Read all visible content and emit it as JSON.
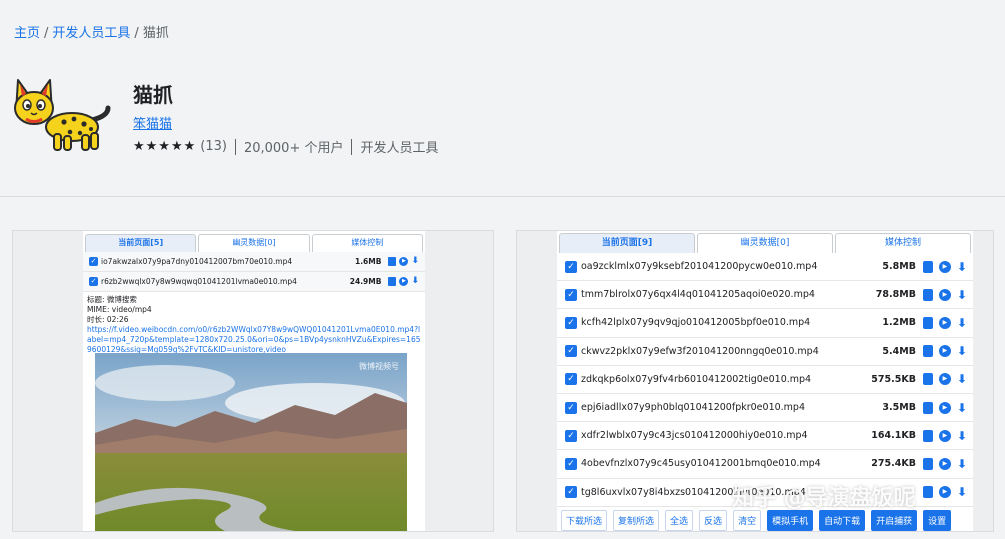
{
  "breadcrumb": {
    "home": "主页",
    "category": "开发人员工具",
    "current": "猫抓"
  },
  "extension": {
    "name": "猫抓",
    "author": "笨猫猫",
    "stars": "★★★★★",
    "rating_count": "(13)",
    "users": "20,000+ 个用户",
    "category": "开发人员工具"
  },
  "left_shot": {
    "tabs": [
      "当前页面[5]",
      "幽灵数据[0]",
      "媒体控制"
    ],
    "rows": [
      {
        "name": "io7akwzalx07y9pa7dny010412007bm70e010.mp4",
        "size": "1.6MB"
      },
      {
        "name": "r6zb2wwqlx07y8w9wqwq01041201lvma0e010.mp4",
        "size": "24.9MB"
      }
    ],
    "info": {
      "title": "标题: 微博搜索",
      "mime": "MIME: video/mp4",
      "duration": "时长: 02:26",
      "url": "https://f.video.weibocdn.com/o0/r6zb2WWqlx07Y8w9wQWQ01041201Lvma0E010.mp4?label=mp4_720p&template=1280x720.25.0&ori=0&ps=1BVp4ysnknHVZu&Expires=1659600129&ssig=Mg059g%2FvTC&KID=unistore,video"
    },
    "watermark": "微博视频号"
  },
  "right_shot": {
    "tabs": [
      "当前页面[9]",
      "幽灵数据[0]",
      "媒体控制"
    ],
    "rows": [
      {
        "name": "oa9zcklmlx07y9ksebf201041200pycw0e010.mp4",
        "size": "5.8MB"
      },
      {
        "name": "tmm7blrolx07y6qx4l4q01041205aqoi0e020.mp4",
        "size": "78.8MB"
      },
      {
        "name": "kcfh42lplx07y9qv9qjo010412005bpf0e010.mp4",
        "size": "1.2MB"
      },
      {
        "name": "ckwvz2pklx07y9efw3f201041200nngq0e010.mp4",
        "size": "5.4MB"
      },
      {
        "name": "zdkqkp6olx07y9fv4rb6010412002tig0e010.mp4",
        "size": "575.5KB"
      },
      {
        "name": "epj6iadllx07y9ph0blq01041200fpkr0e010.mp4",
        "size": "3.5MB"
      },
      {
        "name": "xdfr2lwblx07y9c43jcs010412000hiy0e010.mp4",
        "size": "164.1KB"
      },
      {
        "name": "4obevfnzlx07y9c45usy010412001bmq0e010.mp4",
        "size": "275.4KB"
      },
      {
        "name": "tg8l6uxvlx07y8i4bxzs01041200lhvt0e010.mp4",
        "size": ""
      }
    ],
    "buttons": {
      "download_selected": "下载所选",
      "copy_selected": "复制所选",
      "select_all": "全选",
      "invert": "反选",
      "clear": "清空",
      "mobile": "模拟手机",
      "auto_download": "自动下载",
      "capture": "开启捕获",
      "settings": "设置"
    }
  },
  "overlay_watermark": "知乎 @导演盘饭呢",
  "icons": {
    "checkbox": "check-icon",
    "copy": "copy-icon",
    "play": "play-icon",
    "download": "download-icon"
  },
  "colors": {
    "accent": "#1a73e8",
    "background": "#f1f3f4"
  }
}
